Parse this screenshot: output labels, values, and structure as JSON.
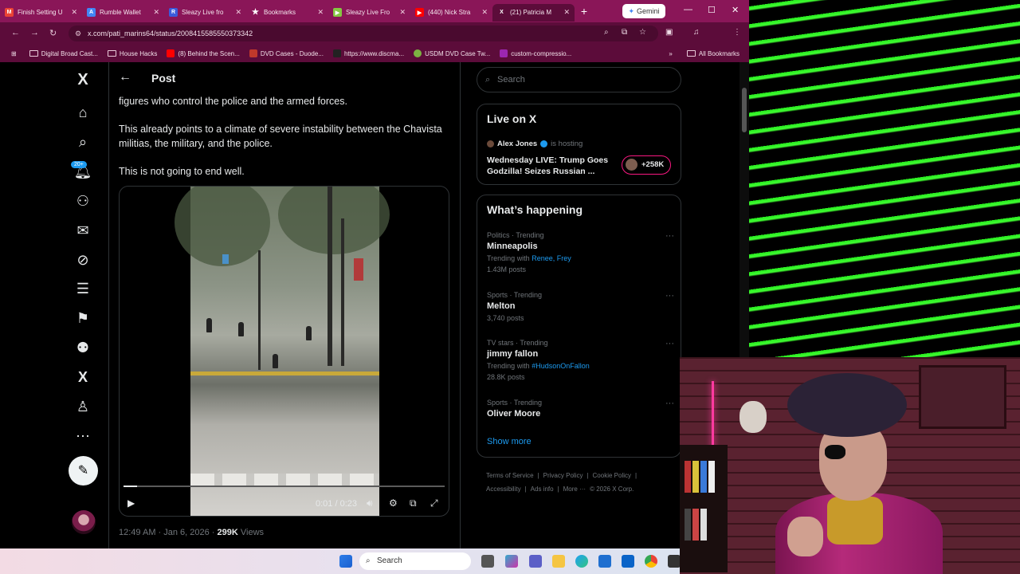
{
  "browser": {
    "tabs": [
      {
        "label": "Finish Setting U",
        "color": "#ea4335",
        "glyph": "M"
      },
      {
        "label": "Rumble Wallet",
        "color": "#4285f4",
        "glyph": "A"
      },
      {
        "label": "Sleazy Live fro",
        "color": "#3b5bdb",
        "glyph": "R"
      },
      {
        "label": "Bookmarks",
        "color": "",
        "glyph": "★"
      },
      {
        "label": "Sleazy Live Fro",
        "color": "#85c742",
        "glyph": "▶"
      },
      {
        "label": "(440) Nick Stra",
        "color": "#ff0000",
        "glyph": "▶"
      },
      {
        "label": "(21) Patricia M",
        "color": "",
        "glyph": "X"
      }
    ],
    "gemini_label": "Gemini",
    "url": "x.com/pati_marins64/status/2008415585550373342",
    "bookmarks": [
      {
        "label": "Digital Broad Cast...",
        "type": "folder"
      },
      {
        "label": "House Hacks",
        "type": "folder"
      },
      {
        "label": "(8) Behind the Scen...",
        "type": "youtube"
      },
      {
        "label": "DVD Cases - Duode...",
        "type": "site"
      },
      {
        "label": "https://www.discma...",
        "type": "site"
      },
      {
        "label": "USDM DVD Case Tw...",
        "type": "site"
      },
      {
        "label": "custom-compressio...",
        "type": "site"
      }
    ],
    "all_bookmarks_label": "All Bookmarks"
  },
  "post": {
    "header_title": "Post",
    "paragraphs": [
      "figures who control the police and the armed forces.",
      "This already points to a climate of severe instability between the Chavista militias, the military, and the police.",
      "This is not going to end well."
    ],
    "video": {
      "time": "0:01 / 0:23",
      "progress_fraction": 0.043
    },
    "timestamp": "12:49 AM · Jan 6, 2026 · ",
    "views_count": "299K",
    "views_label": " Views"
  },
  "nav": {
    "notification_badge": "20+"
  },
  "sidebar": {
    "search_placeholder": "Search",
    "live": {
      "title": "Live on X",
      "host_name": "Alex Jones",
      "host_suffix": "is hosting",
      "broadcast_title": "Wednesday LIVE: Trump Goes Godzilla! Seizes Russian ...",
      "listeners": "+258K"
    },
    "happening": {
      "title": "What’s happening",
      "trends": [
        {
          "meta": "Politics · Trending",
          "name": "Minneapolis",
          "with_label": "Trending with ",
          "with_links": "Renee, Frey",
          "count": "1.43M posts"
        },
        {
          "meta": "Sports · Trending",
          "name": "Melton",
          "with_label": "",
          "with_links": "",
          "count": "3,740 posts"
        },
        {
          "meta": "TV stars · Trending",
          "name": "jimmy fallon",
          "with_label": "Trending with ",
          "with_links": "#HudsonOnFallon",
          "count": "28.8K posts"
        },
        {
          "meta": "Sports · Trending",
          "name": "Oliver Moore",
          "with_label": "",
          "with_links": "",
          "count": ""
        }
      ],
      "show_more": "Show more"
    },
    "footer": [
      "Terms of Service",
      "|",
      "Privacy Policy",
      "|",
      "Cookie Policy",
      "|",
      "Accessibility",
      "|",
      "Ads info",
      "|",
      "More ···",
      "© 2026 X Corp."
    ]
  },
  "taskbar": {
    "search_label": "Search"
  }
}
